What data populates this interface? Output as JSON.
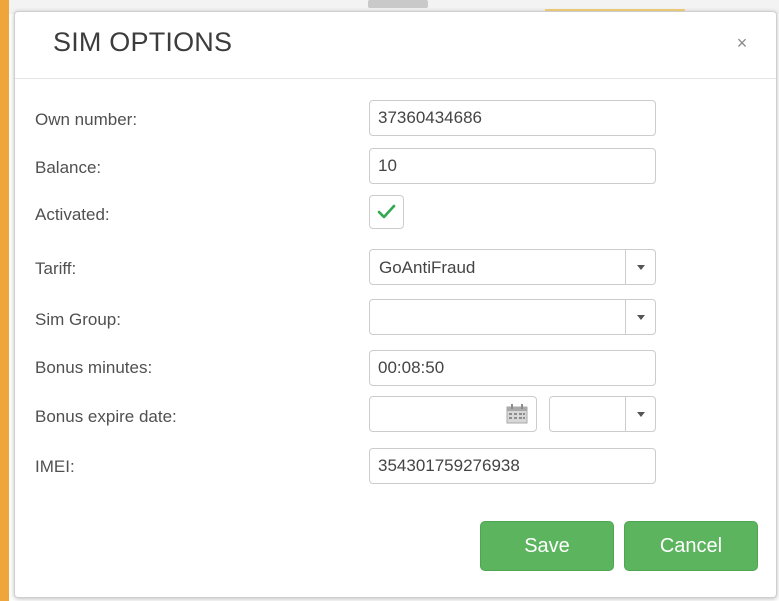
{
  "modal": {
    "title": "SIM OPTIONS",
    "close_glyph": "×"
  },
  "fields": {
    "own_number": {
      "label": "Own number:",
      "value": "37360434686"
    },
    "balance": {
      "label": "Balance:",
      "value": "10"
    },
    "activated": {
      "label": "Activated:",
      "checked": true
    },
    "tariff": {
      "label": "Tariff:",
      "value": "GoAntiFraud"
    },
    "sim_group": {
      "label": "Sim Group:",
      "value": ""
    },
    "bonus_minutes": {
      "label": "Bonus minutes:",
      "value": "00:08:50"
    },
    "bonus_expire_date": {
      "label": "Bonus expire date:",
      "date_value": "",
      "time_value": ""
    },
    "imei": {
      "label": "IMEI:",
      "value": "354301759276938"
    }
  },
  "buttons": {
    "save": "Save",
    "cancel": "Cancel"
  },
  "icons": {
    "close": "close-icon",
    "check": "checkmark-icon",
    "calendar": "calendar-icon",
    "dropdown": "chevron-down-icon"
  },
  "colors": {
    "button_green": "#5cb45f",
    "check_green": "#2fa84f",
    "background_accent": "#f0a53a"
  }
}
